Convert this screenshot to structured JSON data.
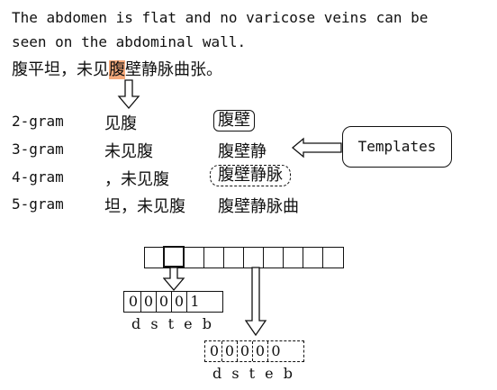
{
  "sentence_en_line1": "The abdomen is flat and no varicose veins can be",
  "sentence_en_line2": "seen on the abdominal wall.",
  "sentence_zh_before": "腹平坦，未见",
  "sentence_zh_highlight": "腹",
  "sentence_zh_after": "壁静脉曲张。",
  "ngrams": [
    {
      "label": "2-gram",
      "left": "见腹",
      "right": "腹壁"
    },
    {
      "label": "3-gram",
      "left": "未见腹",
      "right": "腹壁静"
    },
    {
      "label": "4-gram",
      "left": "，未见腹",
      "right": "腹壁静脉"
    },
    {
      "label": "5-gram",
      "left": "坦，未见腹",
      "right": "腹壁静脉曲"
    }
  ],
  "templates_label": "Templates",
  "vector1": {
    "bits": [
      "0",
      "0",
      "0",
      "0",
      "1"
    ],
    "features": "d s t e b"
  },
  "vector2": {
    "bits": [
      "0",
      "0",
      "0",
      "0",
      "0"
    ],
    "features": "d s t e b"
  },
  "feature_array_cells": 10
}
